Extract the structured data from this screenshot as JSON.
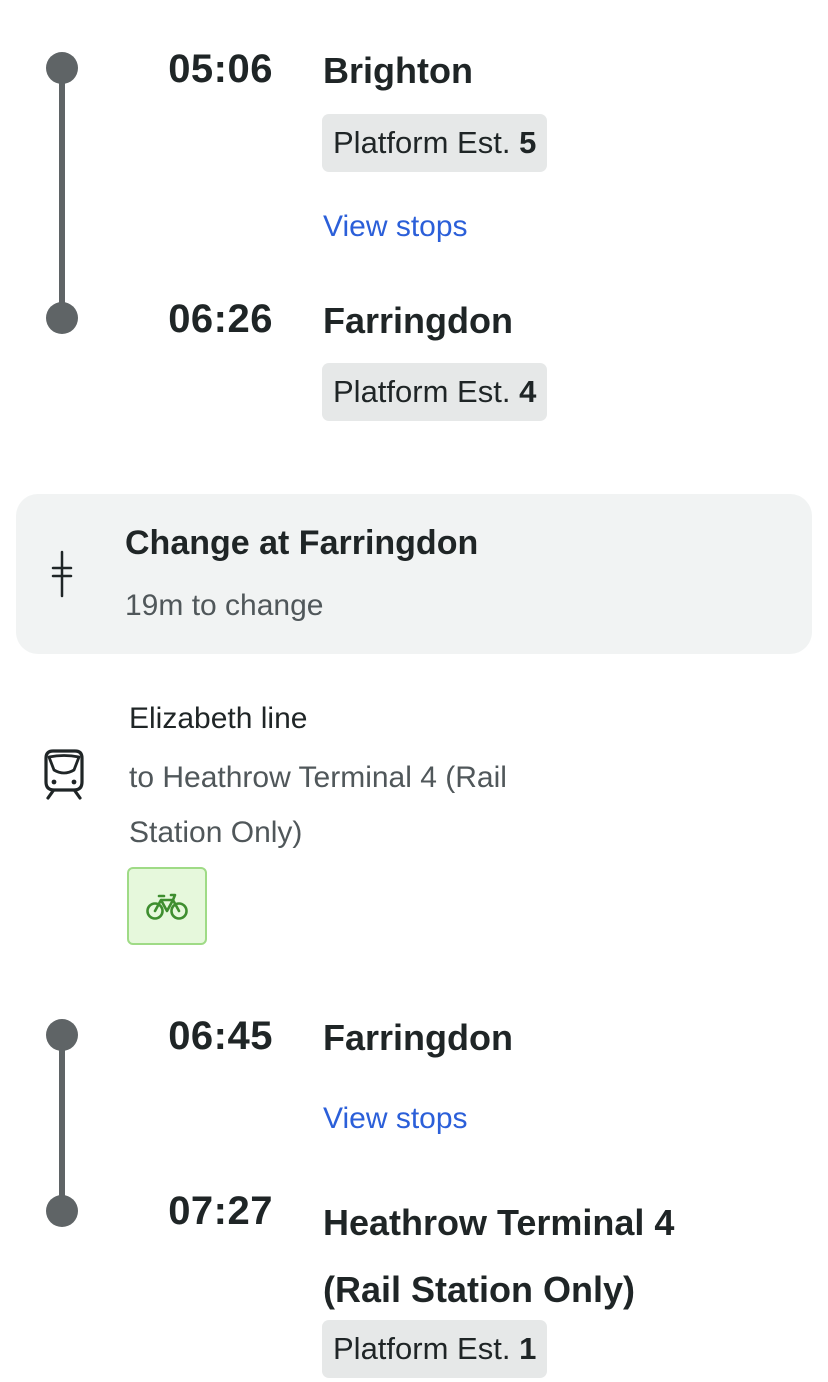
{
  "legs": [
    {
      "departure": {
        "time": "05:06",
        "station": "Brighton",
        "platform_label": "Platform Est.",
        "platform_number": "5"
      },
      "view_stops_label": "View stops",
      "arrival": {
        "time": "06:26",
        "station": "Farringdon",
        "platform_label": "Platform Est.",
        "platform_number": "4"
      }
    },
    {
      "departure": {
        "time": "06:45",
        "station": "Farringdon"
      },
      "view_stops_label": "View stops",
      "arrival": {
        "time": "07:27",
        "station": "Heathrow Terminal 4 (Rail Station Only)",
        "platform_label": "Platform Est.",
        "platform_number": "1"
      }
    }
  ],
  "change": {
    "title": "Change at Farringdon",
    "subtitle": "19m to change",
    "icon": "change-icon"
  },
  "service": {
    "line_name": "Elizabeth line",
    "destination": "to Heathrow Terminal 4 (Rail Station Only)",
    "icon": "train-icon",
    "amenity_icon": "bicycle-icon",
    "colors": {
      "rail": "#5f6466",
      "link": "#2b5fd9",
      "bike_badge_bg": "#e6f8dc",
      "bike_badge_border": "#9fdb86",
      "bike_icon": "#3e8e2f"
    }
  }
}
